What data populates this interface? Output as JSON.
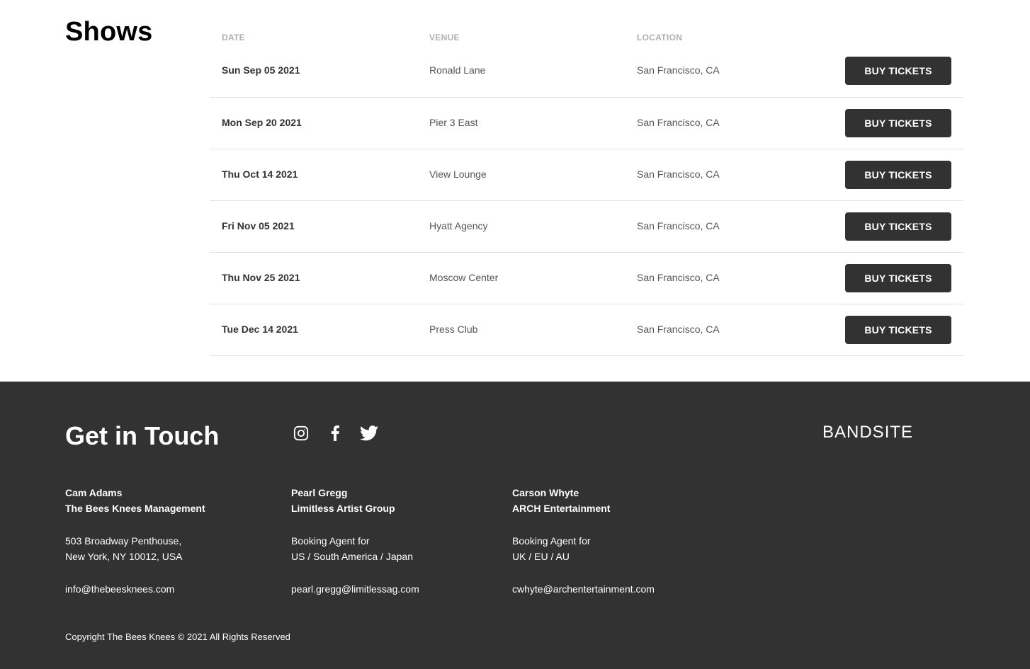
{
  "shows": {
    "title": "Shows",
    "headers": {
      "date": "DATE",
      "venue": "VENUE",
      "location": "LOCATION"
    },
    "rows": [
      {
        "date": "Sun Sep 05 2021",
        "venue": "Ronald Lane",
        "location": "San Francisco, CA",
        "button": "BUY TICKETS"
      },
      {
        "date": "Mon Sep 20 2021",
        "venue": "Pier 3 East",
        "location": "San Francisco, CA",
        "button": "BUY TICKETS"
      },
      {
        "date": "Thu Oct 14 2021",
        "venue": "View Lounge",
        "location": "San Francisco, CA",
        "button": "BUY TICKETS"
      },
      {
        "date": "Fri Nov 05 2021",
        "venue": "Hyatt Agency",
        "location": "San Francisco, CA",
        "button": "BUY TICKETS"
      },
      {
        "date": "Thu Nov 25 2021",
        "venue": "Moscow Center",
        "location": "San Francisco, CA",
        "button": "BUY TICKETS"
      },
      {
        "date": "Tue Dec 14 2021",
        "venue": "Press Club",
        "location": "San Francisco, CA",
        "button": "BUY TICKETS"
      }
    ]
  },
  "footer": {
    "title": "Get in Touch",
    "social_icons": [
      "instagram-icon",
      "facebook-icon",
      "twitter-icon"
    ],
    "logo": "BANDSITE",
    "contacts": [
      {
        "name": "Cam Adams",
        "org": "The Bees Knees Management",
        "line1": "503 Broadway Penthouse,",
        "line2": "New York, NY 10012, USA",
        "email": "info@thebeesknees.com"
      },
      {
        "name": "Pearl Gregg",
        "org": "Limitless Artist Group",
        "line1": "Booking Agent for",
        "line2": "US / South America / Japan",
        "email": "pearl.gregg@limitlessag.com"
      },
      {
        "name": "Carson Whyte",
        "org": "ARCH Entertainment",
        "line1": "Booking Agent for",
        "line2": "UK / EU / AU",
        "email": "cwhyte@archentertainment.com"
      }
    ],
    "copyright": "Copyright The Bees Knees © 2021 All Rights Reserved"
  },
  "colors": {
    "dark": "#323232",
    "muted": "#afafaf",
    "divider": "#e1e1e1",
    "white": "#ffffff"
  }
}
